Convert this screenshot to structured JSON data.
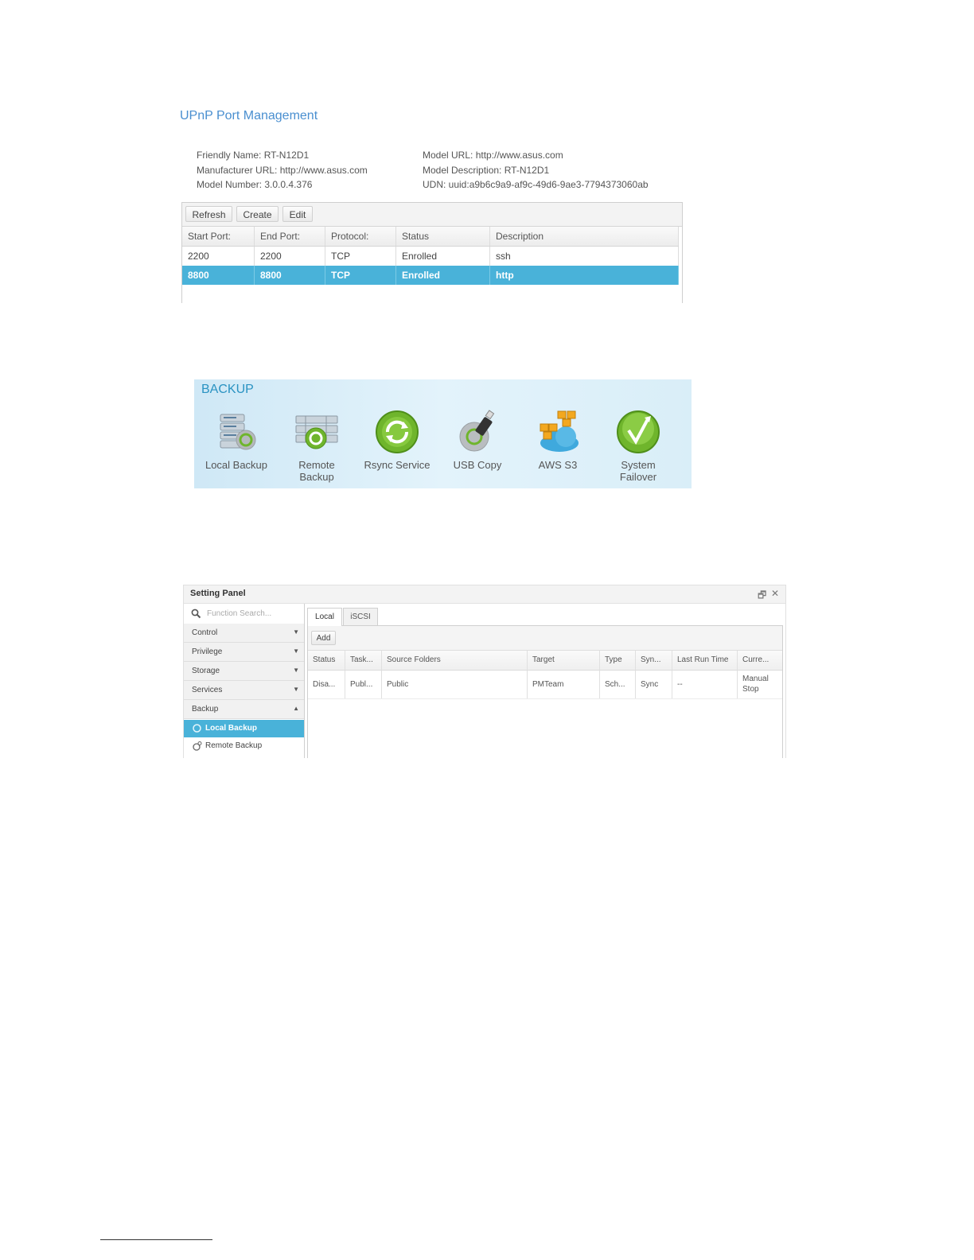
{
  "upnp": {
    "title": "UPnP Port Management",
    "info": {
      "friendly_name": "Friendly Name: RT-N12D1",
      "manufacturer_url": "Manufacturer URL: http://www.asus.com",
      "model_number": "Model Number: 3.0.0.4.376",
      "model_url": "Model URL: http://www.asus.com",
      "model_description": "Model Description: RT-N12D1",
      "udn": "UDN: uuid:a9b6c9a9-af9c-49d6-9ae3-7794373060ab"
    },
    "toolbar": {
      "refresh": "Refresh",
      "create": "Create",
      "edit": "Edit"
    },
    "columns": [
      "Start Port:",
      "End Port:",
      "Protocol:",
      "Status",
      "Description"
    ],
    "rows": [
      [
        "2200",
        "2200",
        "TCP",
        "Enrolled",
        "ssh"
      ],
      [
        "8800",
        "8800",
        "TCP",
        "Enrolled",
        "http"
      ]
    ],
    "selected_row": 1,
    "colors": {
      "title": "#4a8fd0",
      "selected_row": "#49b2d9"
    }
  },
  "backup": {
    "title": "BACKUP",
    "items": [
      {
        "line1": "Local Backup",
        "line2": "",
        "icon": "local-backup-icon"
      },
      {
        "line1": "Remote",
        "line2": "Backup",
        "icon": "remote-backup-icon"
      },
      {
        "line1": "Rsync Service",
        "line2": "",
        "icon": "rsync-service-icon"
      },
      {
        "line1": "USB Copy",
        "line2": "",
        "icon": "usb-copy-icon"
      },
      {
        "line1": "AWS S3",
        "line2": "",
        "icon": "aws-s3-icon"
      },
      {
        "line1": "System",
        "line2": "Failover",
        "icon": "system-failover-icon"
      }
    ],
    "colors": {
      "title": "#2a93c2",
      "green": "#6fb52c"
    }
  },
  "setting_panel": {
    "title": "Setting Panel",
    "search_placeholder": "Function Search...",
    "sidebar": [
      "Control",
      "Privilege",
      "Storage",
      "Services",
      "Backup"
    ],
    "sub_items": [
      "Local Backup",
      "Remote Backup"
    ],
    "tabs": [
      "Local",
      "iSCSI"
    ],
    "add_label": "Add",
    "columns": [
      "Status",
      "Task...",
      "Source Folders",
      "Target",
      "Type",
      "Syn...",
      "Last Run Time",
      "Curre..."
    ],
    "row": [
      "Disa...",
      "Publ...",
      "Public",
      "PMTeam",
      "Sch...",
      "Sync",
      "--",
      "Manual",
      "Stop"
    ],
    "colors": {
      "selected": "#49b2d9"
    }
  }
}
